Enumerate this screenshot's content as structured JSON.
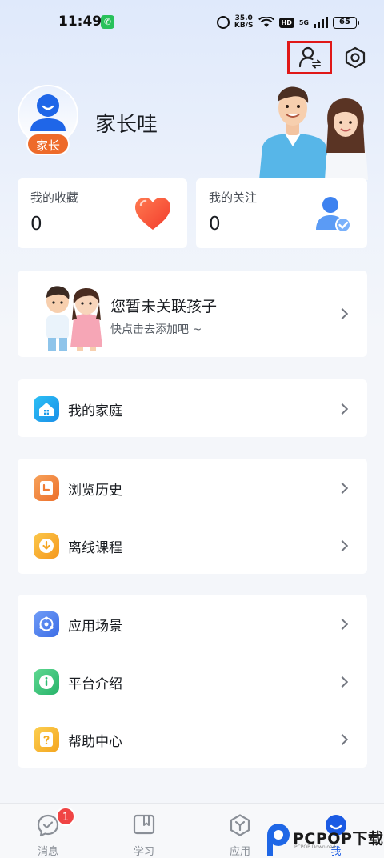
{
  "status_bar": {
    "time": "11:49",
    "net_speed_value": "35.0",
    "net_speed_unit": "KB/S",
    "hd_label": "HD",
    "signal_label": "5G",
    "battery": "65"
  },
  "profile": {
    "name": "家长哇",
    "role_tag": "家长"
  },
  "stats": {
    "favorites": {
      "label": "我的收藏",
      "count": "0"
    },
    "following": {
      "label": "我的关注",
      "count": "0"
    }
  },
  "children": {
    "title": "您暂未关联孩子",
    "subtitle": "快点击去添加吧 ~"
  },
  "menu_groups": [
    {
      "items": [
        {
          "label": "我的家庭",
          "icon": "home-icon",
          "color": "#1fa7f0"
        }
      ]
    },
    {
      "items": [
        {
          "label": "浏览历史",
          "icon": "history-icon",
          "color": "#f08a3a"
        },
        {
          "label": "离线课程",
          "icon": "download-icon",
          "color": "#f5a623"
        }
      ]
    },
    {
      "items": [
        {
          "label": "应用场景",
          "icon": "scene-icon",
          "color": "#4f7ff0"
        },
        {
          "label": "平台介绍",
          "icon": "info-icon",
          "color": "#34c27a"
        },
        {
          "label": "帮助中心",
          "icon": "help-icon",
          "color": "#f5b324"
        }
      ]
    }
  ],
  "tabbar": {
    "tabs": [
      {
        "label": "消息",
        "icon": "message-icon",
        "badge": "1"
      },
      {
        "label": "学习",
        "icon": "study-icon"
      },
      {
        "label": "应用",
        "icon": "apps-icon"
      },
      {
        "label": "我",
        "icon": "me-icon",
        "active": true
      }
    ]
  },
  "watermark": {
    "text": "PCPOP下载",
    "sub": "PCPOP Download"
  },
  "colors": {
    "accent": "#1b5be4",
    "highlight_box": "#e01818",
    "tag": "#ee6b2a"
  }
}
